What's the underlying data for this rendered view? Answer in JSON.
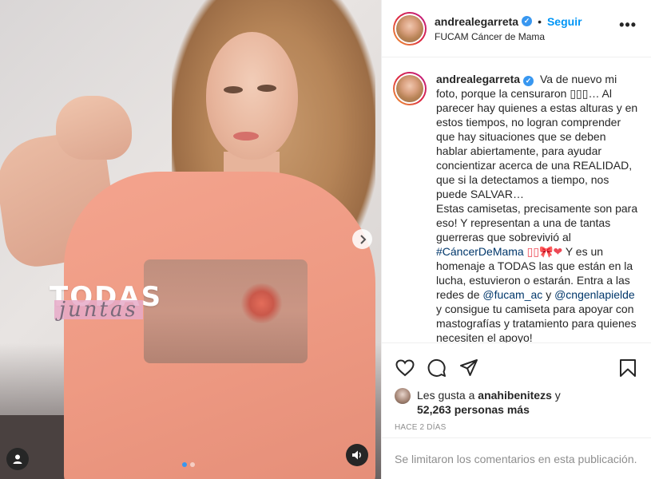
{
  "post": {
    "overlay_title": "TODAS",
    "overlay_subtitle": "juntas",
    "carousel": {
      "count": 2,
      "active_index": 0
    }
  },
  "header": {
    "username": "andrealegarreta",
    "bullet": "•",
    "follow_label": "Seguir",
    "location": "FUCAM Cáncer de Mama",
    "more_label": "•••"
  },
  "caption": {
    "username": "andrealegarreta",
    "part1": "Va de nuevo mi foto, porque la censuraron ▯▯▯… Al parecer hay quienes a estas alturas y en estos tiempos, no logran comprender que hay situaciones que se deben hablar abiertamente, para ayudar concientizar acerca de una REALIDAD, que si la detectamos a tiempo, nos puede SALVAR…",
    "part2": "Estas camisetas, precisamente son para eso! Y representan a una de tantas guerreras que sobrevivió al",
    "hashtag": "#CáncerDeMama",
    "emoji": "▯▯🎀❤",
    "part3": "Y es un homenaje a TODAS las que están en la lucha, estuvieron o estarán. Entra a las redes de",
    "mention1": "@fucam_ac",
    "and": "y",
    "mention2": "@cngenlapielde",
    "part4": "y consigue tu camiseta para apoyar con mastografías y tratamiento para quienes necesiten el apoyo!"
  },
  "likes": {
    "prefix": "Les gusta a",
    "user": "anahibenitezs",
    "conj": "y",
    "count": "52,263 personas más"
  },
  "time_ago": "HACE 2 DÍAS",
  "comments_disabled": "Se limitaron los comentarios en esta publicación.",
  "icons": [
    "heart-icon",
    "comment-icon",
    "share-icon",
    "save-icon",
    "user-tag-icon",
    "audio-icon",
    "chevron-right-icon",
    "verified-icon",
    "more-icon"
  ],
  "colors": {
    "link": "#0095f6",
    "hashtag": "#00376b",
    "muted": "#8e8e8e",
    "verified": "#3897f0"
  }
}
